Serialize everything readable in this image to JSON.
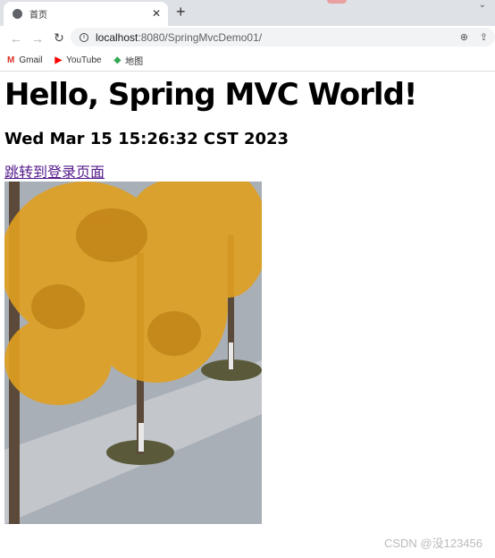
{
  "browser": {
    "tab_title": "首页",
    "url_host": "localhost",
    "url_path": ":8080/SpringMvcDemo01/",
    "bookmarks": [
      {
        "label": "Gmail",
        "icon": "gmail-icon"
      },
      {
        "label": "YouTube",
        "icon": "youtube-icon"
      },
      {
        "label": "地图",
        "icon": "maps-icon"
      }
    ]
  },
  "page": {
    "heading": "Hello, Spring MVC World!",
    "date": "Wed Mar 15 15:26:32 CST 2023",
    "link": "跳转到登录页面"
  },
  "watermark": "CSDN @没123456"
}
